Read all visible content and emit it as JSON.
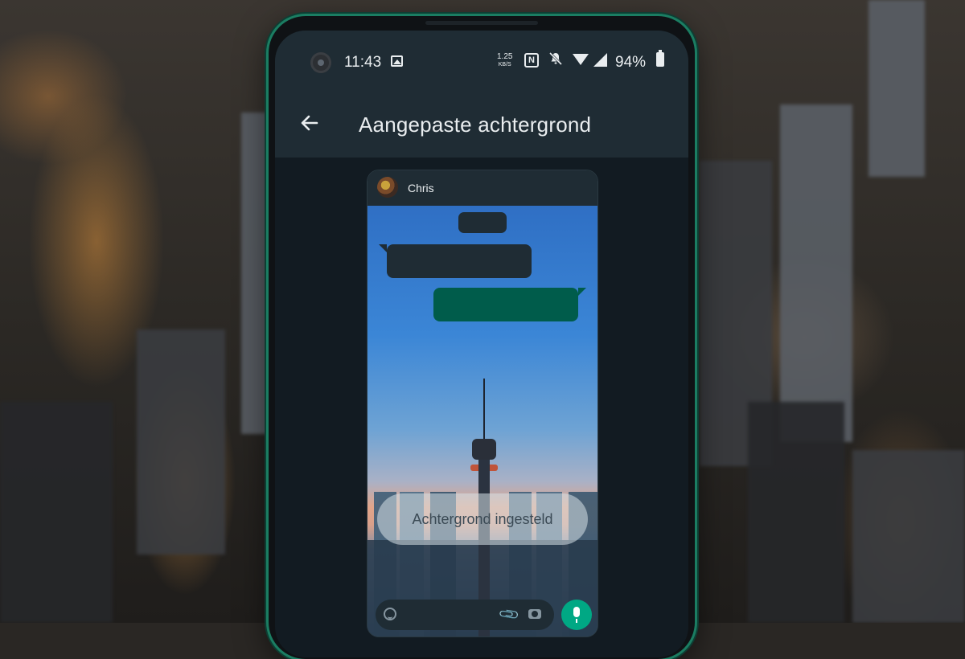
{
  "status_bar": {
    "time": "11:43",
    "speed_value": "1.25",
    "speed_unit": "KB/S",
    "nfc_letter": "N",
    "battery": "94%"
  },
  "app_bar": {
    "title": "Aangepaste achtergrond"
  },
  "preview": {
    "contact_name": "Chris",
    "toast": "Achtergrond ingesteld"
  },
  "colors": {
    "app_bar": "#1f2c34",
    "outgoing_bubble": "#005c4b",
    "accent": "#00a884",
    "phone_frame": "#1b7d62"
  },
  "icons": [
    "back-arrow-icon",
    "gallery-icon",
    "nfc-icon",
    "mute-icon",
    "wifi-icon",
    "signal-icon",
    "battery-icon",
    "emoji-icon",
    "attach-icon",
    "camera-icon",
    "mic-icon"
  ]
}
